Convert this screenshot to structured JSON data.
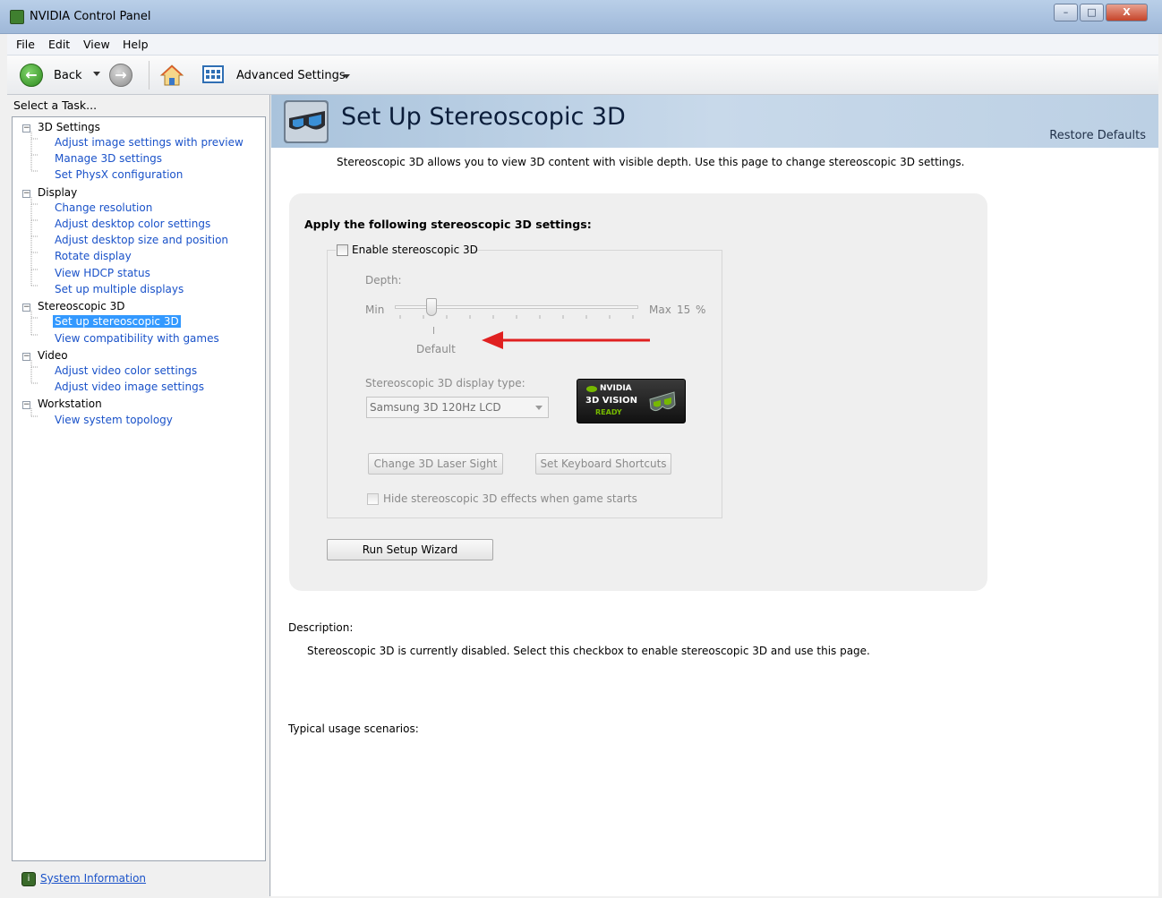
{
  "window": {
    "title": "NVIDIA Control Panel",
    "controls": {
      "minimize": "–",
      "maximize": "□",
      "close": "X"
    }
  },
  "menu": [
    "File",
    "Edit",
    "View",
    "Help"
  ],
  "toolbar": {
    "back_label": "Back",
    "view_label": "Advanced Settings"
  },
  "sidebar": {
    "header": "Select a Task...",
    "tree": [
      {
        "label": "3D Settings",
        "children": [
          "Adjust image settings with preview",
          "Manage 3D settings",
          "Set PhysX configuration"
        ]
      },
      {
        "label": "Display",
        "children": [
          "Change resolution",
          "Adjust desktop color settings",
          "Adjust desktop size and position",
          "Rotate display",
          "View HDCP status",
          "Set up multiple displays"
        ]
      },
      {
        "label": "Stereoscopic 3D",
        "children": [
          "Set up stereoscopic 3D",
          "View compatibility with games"
        ]
      },
      {
        "label": "Video",
        "children": [
          "Adjust video color settings",
          "Adjust video image settings"
        ]
      },
      {
        "label": "Workstation",
        "children": [
          "View system topology"
        ]
      }
    ],
    "selected": "Set up stereoscopic 3D",
    "system_information": "System Information"
  },
  "page": {
    "title": "Set Up Stereoscopic 3D",
    "restore_defaults": "Restore Defaults",
    "intro": "Stereoscopic 3D allows you to view 3D content with visible depth. Use this page to change stereoscopic 3D settings.",
    "settings_heading": "Apply the following stereoscopic 3D settings:",
    "enable_label": "Enable stereoscopic 3D",
    "enable_checked": false,
    "depth_label": "Depth:",
    "depth_min": "Min",
    "depth_max": "Max",
    "depth_value": "15",
    "depth_unit": "%",
    "depth_fraction": 0.15,
    "depth_default_label": "Default",
    "display_type_label": "Stereoscopic 3D display type:",
    "display_type_value": "Samsung 3D 120Hz LCD",
    "badge": {
      "brand": "NVIDIA",
      "product": "3D VISION",
      "status": "READY"
    },
    "laser_sight_button": "Change 3D Laser Sight",
    "shortcuts_button": "Set Keyboard Shortcuts",
    "hide_effects_label": "Hide stereoscopic 3D effects when game starts",
    "hide_effects_checked": false,
    "wizard_button": "Run Setup Wizard",
    "description_heading": "Description:",
    "description_text": "Stereoscopic 3D is currently disabled. Select this checkbox to enable stereoscopic 3D and use this page.",
    "usage_heading": "Typical usage scenarios:"
  },
  "colors": {
    "link": "#1a52c9",
    "selection": "#3399ff",
    "annotation_arrow": "#e02020",
    "nvidia_green": "#76b900"
  }
}
